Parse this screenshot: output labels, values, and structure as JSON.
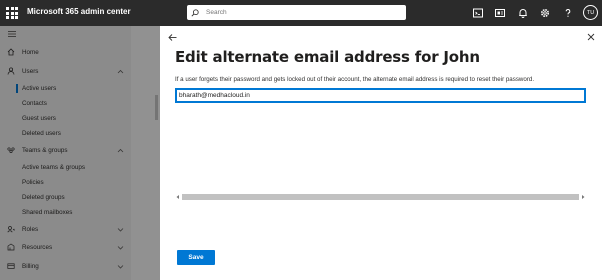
{
  "app": {
    "title": "Microsoft 365 admin center"
  },
  "search": {
    "placeholder": "Search"
  },
  "header_icons": [
    "terminal-icon",
    "mail-icon",
    "bell-icon",
    "gear-icon",
    "help-icon"
  ],
  "user": {
    "initials": "TU"
  },
  "sidebar": {
    "items": [
      {
        "label": "Home",
        "icon": "home-icon"
      },
      {
        "label": "Users",
        "icon": "user-icon",
        "expanded": true
      },
      {
        "label": "Active users",
        "active": true
      },
      {
        "label": "Contacts"
      },
      {
        "label": "Guest users"
      },
      {
        "label": "Deleted users"
      },
      {
        "label": "Teams & groups",
        "icon": "teams-icon",
        "expanded": true
      },
      {
        "label": "Active teams & groups"
      },
      {
        "label": "Policies"
      },
      {
        "label": "Deleted groups"
      },
      {
        "label": "Shared mailboxes"
      },
      {
        "label": "Roles",
        "icon": "roles-icon",
        "expanded": false
      },
      {
        "label": "Resources",
        "icon": "resources-icon",
        "expanded": false
      },
      {
        "label": "Billing",
        "icon": "billing-icon",
        "expanded": false
      }
    ]
  },
  "panel": {
    "title": "Edit alternate email address for John",
    "description": "If a user forgets their password and gets locked out of their account, the alternate email address is required to reset their password.",
    "email_value": "bharath@medhacloud.in",
    "save_label": "Save"
  },
  "colors": {
    "accent": "#0078d4",
    "topbar": "#2b2b2b"
  }
}
